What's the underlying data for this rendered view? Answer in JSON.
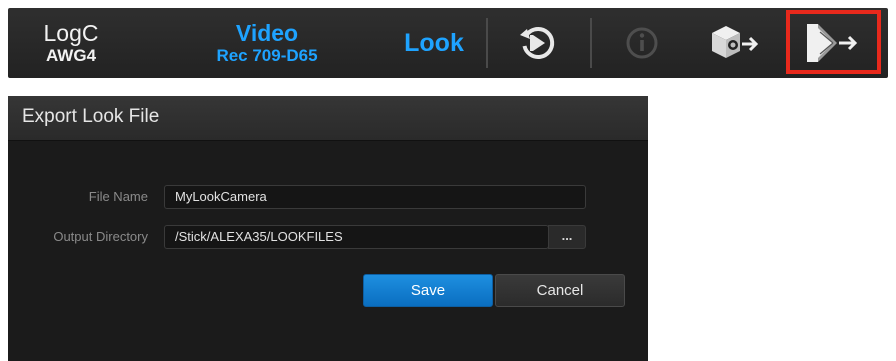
{
  "toolbar": {
    "logc_main": "LogC",
    "logc_sub": "AWG4",
    "video_main": "Video",
    "video_sub": "Rec 709-D65",
    "look_label": "Look",
    "icons": [
      "reset-look-icon",
      "info-icon",
      "export-camera-icon",
      "export-look-file-icon"
    ]
  },
  "dialog": {
    "title": "Export Look File",
    "file_name_label": "File Name",
    "file_name_value": "MyLookCamera",
    "output_dir_label": "Output Directory",
    "output_dir_value": "/Stick/ALEXA35/LOOKFILES",
    "browse_label": "...",
    "save_label": "Save",
    "cancel_label": "Cancel"
  },
  "colors": {
    "accent": "#1ea3ff",
    "highlight": "#e8291c",
    "save_button": "#0f7bd0"
  }
}
